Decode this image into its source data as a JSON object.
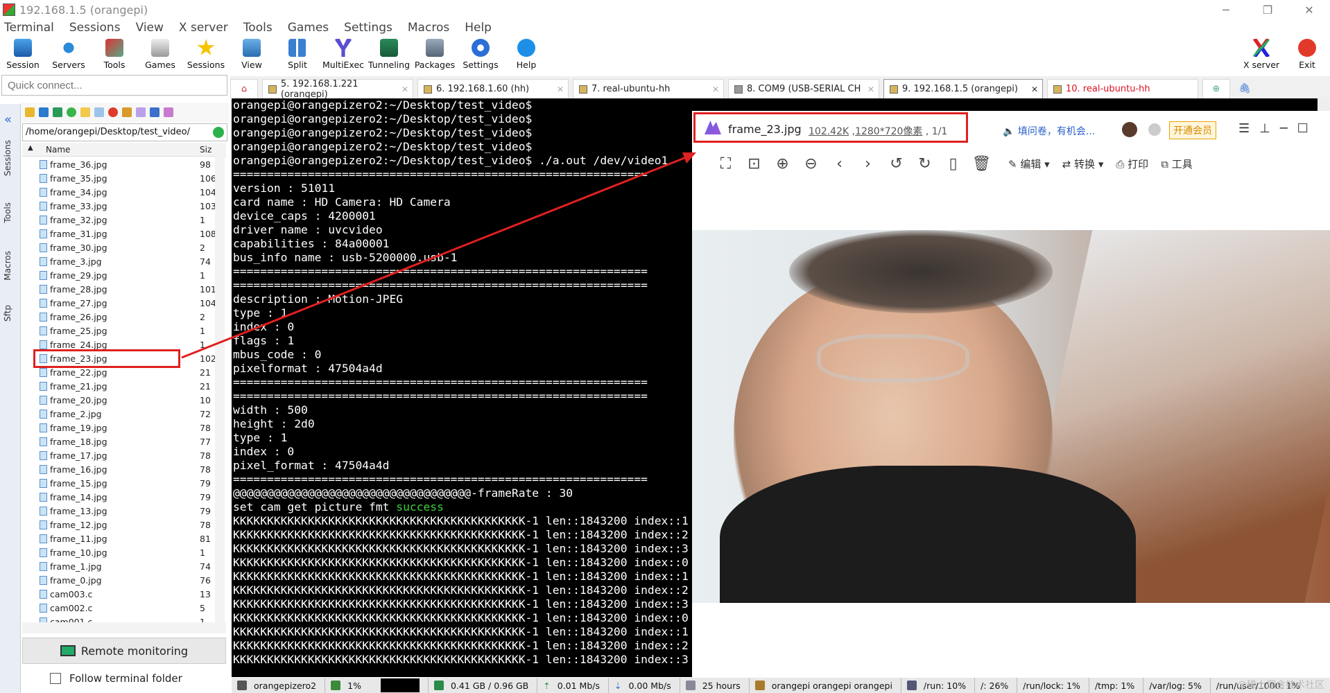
{
  "window": {
    "title": "192.168.1.5 (orangepi)"
  },
  "menu": [
    "Terminal",
    "Sessions",
    "View",
    "X server",
    "Tools",
    "Games",
    "Settings",
    "Macros",
    "Help"
  ],
  "toolbar": {
    "left": [
      "Session",
      "Servers",
      "Tools",
      "Games",
      "Sessions",
      "View",
      "Split",
      "MultiExec",
      "Tunneling",
      "Packages",
      "Settings",
      "Help"
    ],
    "right": [
      "X server",
      "Exit"
    ]
  },
  "quick_connect": {
    "placeholder": "Quick connect..."
  },
  "tabs": [
    {
      "label": "5. 192.168.1.221 (orangepi)"
    },
    {
      "label": "6. 192.168.1.60 (hh)"
    },
    {
      "label": "7. real-ubuntu-hh"
    },
    {
      "label": "8. COM9  (USB-SERIAL CH"
    },
    {
      "label": "9. 192.168.1.5 (orangepi)"
    },
    {
      "label": "10. real-ubuntu-hh"
    }
  ],
  "side_tabs": [
    "Sessions",
    "Tools",
    "Macros",
    "Sftp"
  ],
  "file_browser": {
    "path": "/home/orangepi/Desktop/test_video/",
    "col_name": "Name",
    "col_size": "Siz",
    "files": [
      {
        "name": "frame_36.jpg",
        "size": "98"
      },
      {
        "name": "frame_35.jpg",
        "size": "106"
      },
      {
        "name": "frame_34.jpg",
        "size": "104"
      },
      {
        "name": "frame_33.jpg",
        "size": "103"
      },
      {
        "name": "frame_32.jpg",
        "size": "1"
      },
      {
        "name": "frame_31.jpg",
        "size": "108"
      },
      {
        "name": "frame_30.jpg",
        "size": "2"
      },
      {
        "name": "frame_3.jpg",
        "size": "74"
      },
      {
        "name": "frame_29.jpg",
        "size": "1"
      },
      {
        "name": "frame_28.jpg",
        "size": "101"
      },
      {
        "name": "frame_27.jpg",
        "size": "104"
      },
      {
        "name": "frame_26.jpg",
        "size": "2"
      },
      {
        "name": "frame_25.jpg",
        "size": "1"
      },
      {
        "name": "frame_24.jpg",
        "size": "1"
      },
      {
        "name": "frame_23.jpg",
        "size": "102"
      },
      {
        "name": "frame_22.jpg",
        "size": "21"
      },
      {
        "name": "frame_21.jpg",
        "size": "21"
      },
      {
        "name": "frame_20.jpg",
        "size": "10"
      },
      {
        "name": "frame_2.jpg",
        "size": "72"
      },
      {
        "name": "frame_19.jpg",
        "size": "78"
      },
      {
        "name": "frame_18.jpg",
        "size": "77"
      },
      {
        "name": "frame_17.jpg",
        "size": "78"
      },
      {
        "name": "frame_16.jpg",
        "size": "78"
      },
      {
        "name": "frame_15.jpg",
        "size": "79"
      },
      {
        "name": "frame_14.jpg",
        "size": "79"
      },
      {
        "name": "frame_13.jpg",
        "size": "79"
      },
      {
        "name": "frame_12.jpg",
        "size": "78"
      },
      {
        "name": "frame_11.jpg",
        "size": "81"
      },
      {
        "name": "frame_10.jpg",
        "size": "1"
      },
      {
        "name": "frame_1.jpg",
        "size": "74"
      },
      {
        "name": "frame_0.jpg",
        "size": "76"
      },
      {
        "name": "cam003.c",
        "size": "13"
      },
      {
        "name": "cam002.c",
        "size": "5"
      },
      {
        "name": "cam001.c",
        "size": "1"
      }
    ],
    "remote_monitoring": "Remote monitoring",
    "follow_folder": "Follow terminal folder"
  },
  "terminal": {
    "lines": [
      "orangepi@orangepizero2:~/Desktop/test_video$",
      "orangepi@orangepizero2:~/Desktop/test_video$",
      "orangepi@orangepizero2:~/Desktop/test_video$",
      "orangepi@orangepizero2:~/Desktop/test_video$",
      "orangepi@orangepizero2:~/Desktop/test_video$ ./a.out /dev/video1",
      "=============================================================",
      "version : 51011",
      "card name : HD Camera: HD Camera",
      "device_caps : 4200001",
      "driver name : uvcvideo",
      "capabilities : 84a00001",
      "bus_info name : usb-5200000.usb-1",
      "=============================================================",
      "=============================================================",
      "description : Motion-JPEG",
      "type : 1",
      "index : 0",
      "flags : 1",
      "mbus_code : 0",
      "pixelformat : 47504a4d",
      "=============================================================",
      "=============================================================",
      "width : 500",
      "height : 2d0",
      "type : 1",
      "index : 0",
      "pixel_format : 47504a4d",
      "=============================================================",
      "@@@@@@@@@@@@@@@@@@@@@@@@@@@@@@@@@@@-frameRate : 30",
      "set cam get picture fmt ",
      "KKKKKKKKKKKKKKKKKKKKKKKKKKKKKKKKKKKKKKKKKKK-1 len::1843200 index::1",
      "KKKKKKKKKKKKKKKKKKKKKKKKKKKKKKKKKKKKKKKKKKK-1 len::1843200 index::2",
      "KKKKKKKKKKKKKKKKKKKKKKKKKKKKKKKKKKKKKKKKKKK-1 len::1843200 index::3",
      "KKKKKKKKKKKKKKKKKKKKKKKKKKKKKKKKKKKKKKKKKKK-1 len::1843200 index::0",
      "KKKKKKKKKKKKKKKKKKKKKKKKKKKKKKKKKKKKKKKKKKK-1 len::1843200 index::1",
      "KKKKKKKKKKKKKKKKKKKKKKKKKKKKKKKKKKKKKKKKKKK-1 len::1843200 index::2",
      "KKKKKKKKKKKKKKKKKKKKKKKKKKKKKKKKKKKKKKKKKKK-1 len::1843200 index::3",
      "KKKKKKKKKKKKKKKKKKKKKKKKKKKKKKKKKKKKKKKKKKK-1 len::1843200 index::0",
      "KKKKKKKKKKKKKKKKKKKKKKKKKKKKKKKKKKKKKKKKKKK-1 len::1843200 index::1",
      "KKKKKKKKKKKKKKKKKKKKKKKKKKKKKKKKKKKKKKKKKKK-1 len::1843200 index::2",
      "KKKKKKKKKKKKKKKKKKKKKKKKKKKKKKKKKKKKKKKKKKK-1 len::1843200 index::3"
    ],
    "success_word": "success"
  },
  "viewer": {
    "filename": "frame_23.jpg",
    "filesize": "102.42K",
    "dimensions": "1280*720像素",
    "pager": "1/1",
    "ad_text": "填问卷，有机会...",
    "vip_label": "开通会员",
    "tools": [
      "编辑",
      "转换",
      "打印",
      "工具"
    ]
  },
  "status_bar": {
    "host": "orangepizero2",
    "cpu": "1%",
    "memory": "0.41 GB / 0.96 GB",
    "upload": "0.01 Mb/s",
    "download": "0.00 Mb/s",
    "uptime": "25 hours",
    "users": "orangepi  orangepi  orangepi",
    "disks": [
      "/run: 10%",
      "/: 26%",
      "/run/lock: 1%",
      "/tmp: 1%",
      "/var/log: 5%",
      "/run/user/1000: 1%"
    ]
  },
  "watermark": "@稀土掘金技术社区",
  "colors": {
    "highlight_box": "#e02020",
    "arrow": "#e02020",
    "terminal_bg": "#000000",
    "success": "#3bd13b"
  }
}
